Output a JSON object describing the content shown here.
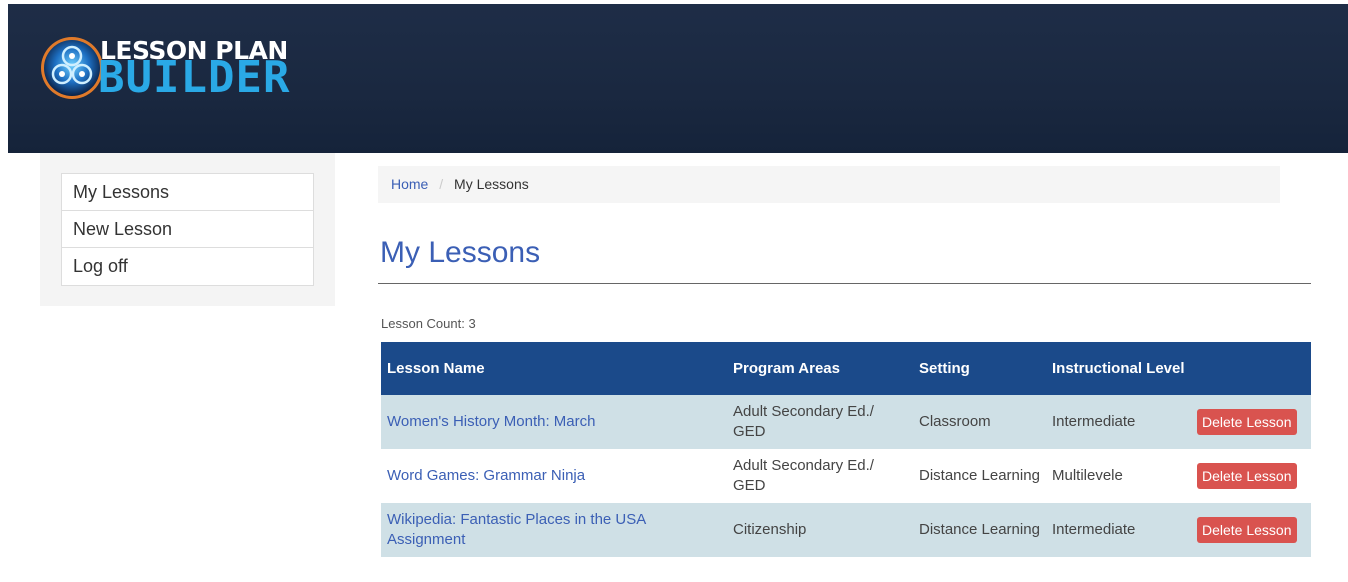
{
  "header": {
    "logo_line1": "LESSON PLAN",
    "logo_line2": "BUILDER"
  },
  "sidebar": {
    "items": [
      {
        "label": "My Lessons"
      },
      {
        "label": "New Lesson"
      },
      {
        "label": "Log off"
      }
    ]
  },
  "breadcrumb": {
    "home": "Home",
    "separator": "/",
    "current": "My Lessons"
  },
  "main": {
    "title": "My Lessons",
    "count_text": "Lesson Count: 3"
  },
  "table": {
    "headers": {
      "name": "Lesson Name",
      "program": "Program Areas",
      "setting": "Setting",
      "level": "Instructional Level",
      "action": ""
    },
    "rows": [
      {
        "name": "Women's History Month: March",
        "program": "Adult Secondary Ed./ GED",
        "setting": "Classroom",
        "level": "Intermediate",
        "action": "Delete Lesson"
      },
      {
        "name": "Word Games: Grammar Ninja",
        "program": "Adult Secondary Ed./ GED",
        "setting": "Distance Learning",
        "level": "Multilevele",
        "action": "Delete Lesson"
      },
      {
        "name": "Wikipedia: Fantastic Places in the USA Assignment",
        "program": "Citizenship",
        "setting": "Distance Learning",
        "level": "Intermediate",
        "action": "Delete Lesson"
      }
    ]
  },
  "colors": {
    "header_bg": "#1a2840",
    "table_header_bg": "#1b4a8a",
    "row_odd_bg": "#cfe0e6",
    "link": "#3b5fb5",
    "delete_button": "#d9534f",
    "logo_accent": "#2aa9e6"
  },
  "icons": {
    "logo": "gear-orb-logo-icon"
  }
}
